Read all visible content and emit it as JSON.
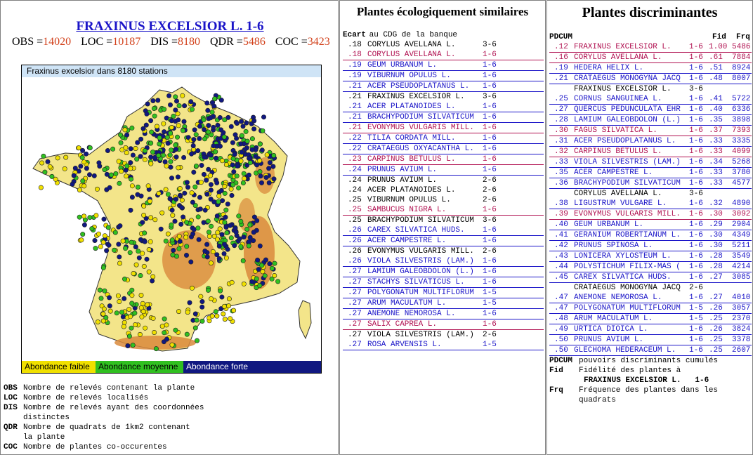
{
  "left": {
    "title": "FRAXINUS EXCELSIOR L. 1-6",
    "stats": [
      {
        "label": "OBS =",
        "value": "14020"
      },
      {
        "label": "LOC =",
        "value": "10187"
      },
      {
        "label": "DIS =",
        "value": "8180"
      },
      {
        "label": "QDR =",
        "value": "5486"
      },
      {
        "label": "COC =",
        "value": "3423"
      }
    ],
    "map": {
      "title": "Fraxinus excelsior dans 8180 stations",
      "legend": [
        "Abondance faible",
        "Abondance moyenne",
        "Abondance forte"
      ],
      "colors": {
        "low": "#f0e000",
        "mid": "#30c020",
        "high": "#101880",
        "land": "#f3e58a",
        "relief": "#d98a3c",
        "sea": "#ffffff"
      }
    },
    "definitions": [
      {
        "key": "OBS",
        "text": "Nombre de relevés contenant la plante"
      },
      {
        "key": "LOC",
        "text": "Nombre de relevés localisés"
      },
      {
        "key": "DIS",
        "text": "Nombre de relevés ayant des coordonnées"
      },
      {
        "key": "",
        "text": "distinctes"
      },
      {
        "key": "QDR",
        "text": "Nombre de quadrats de 1km2 contenant"
      },
      {
        "key": "",
        "text": "la plante"
      },
      {
        "key": "COC",
        "text": "Nombre de plantes co-occurentes"
      }
    ]
  },
  "middle": {
    "title": "Plantes écologiquement similaires",
    "subheader_bold": "Ecart",
    "subheader_rest": " au CDG de la banque",
    "rows": [
      {
        "ecart": ".18",
        "name": "CORYLUS AVELLANA L.",
        "range": "3-6",
        "style": "plain"
      },
      {
        "ecart": ".18",
        "name": "CORYLUS AVELLANA L.",
        "range": "1-6",
        "style": "red"
      },
      {
        "ecart": ".19",
        "name": "GEUM URBANUM L.",
        "range": "1-6",
        "style": "blue"
      },
      {
        "ecart": ".19",
        "name": "VIBURNUM OPULUS L.",
        "range": "1-6",
        "style": "blue"
      },
      {
        "ecart": ".21",
        "name": "ACER PSEUDOPLATANUS L.",
        "range": "1-6",
        "style": "blue"
      },
      {
        "ecart": ".21",
        "name": "FRAXINUS EXCELSIOR L.",
        "range": "3-6",
        "style": "plain"
      },
      {
        "ecart": ".21",
        "name": "ACER PLATANOIDES L.",
        "range": "1-6",
        "style": "blue"
      },
      {
        "ecart": ".21",
        "name": "BRACHYPODIUM SILVATICUM",
        "range": "1-6",
        "style": "blue"
      },
      {
        "ecart": ".21",
        "name": "EVONYMUS VULGARIS MILL.",
        "range": "1-6",
        "style": "red"
      },
      {
        "ecart": ".22",
        "name": "TILIA CORDATA MILL.",
        "range": "1-6",
        "style": "blue"
      },
      {
        "ecart": ".22",
        "name": "CRATAEGUS OXYACANTHA L.",
        "range": "1-6",
        "style": "blue"
      },
      {
        "ecart": ".23",
        "name": "CARPINUS BETULUS L.",
        "range": "1-6",
        "style": "red"
      },
      {
        "ecart": ".24",
        "name": "PRUNUS AVIUM L.",
        "range": "1-6",
        "style": "blue"
      },
      {
        "ecart": ".24",
        "name": "PRUNUS AVIUM L.",
        "range": "2-6",
        "style": "plain"
      },
      {
        "ecart": ".24",
        "name": "ACER PLATANOIDES L.",
        "range": "2-6",
        "style": "plain"
      },
      {
        "ecart": ".25",
        "name": "VIBURNUM OPULUS L.",
        "range": "2-6",
        "style": "plain"
      },
      {
        "ecart": ".25",
        "name": "SAMBUCUS NIGRA L.",
        "range": "1-6",
        "style": "red"
      },
      {
        "ecart": ".25",
        "name": "BRACHYPODIUM SILVATICUM",
        "range": "3-6",
        "style": "plain"
      },
      {
        "ecart": ".26",
        "name": "CAREX SILVATICA HUDS.",
        "range": "1-6",
        "style": "blue"
      },
      {
        "ecart": ".26",
        "name": "ACER CAMPESTRE L.",
        "range": "1-6",
        "style": "blue"
      },
      {
        "ecart": ".26",
        "name": "EVONYMUS VULGARIS MILL.",
        "range": "2-6",
        "style": "plain"
      },
      {
        "ecart": ".26",
        "name": "VIOLA SILVESTRIS (LAM.)",
        "range": "1-6",
        "style": "blue"
      },
      {
        "ecart": ".27",
        "name": "LAMIUM GALEOBDOLON (L.)",
        "range": "1-6",
        "style": "blue"
      },
      {
        "ecart": ".27",
        "name": "STACHYS SILVATICUS L.",
        "range": "1-6",
        "style": "blue"
      },
      {
        "ecart": ".27",
        "name": "POLYGONATUM MULTIFLORUM",
        "range": "1-5",
        "style": "blue"
      },
      {
        "ecart": ".27",
        "name": "ARUM MACULATUM L.",
        "range": "1-5",
        "style": "blue"
      },
      {
        "ecart": ".27",
        "name": "ANEMONE NEMOROSA L.",
        "range": "1-6",
        "style": "blue"
      },
      {
        "ecart": ".27",
        "name": "SALIX CAPREA L.",
        "range": "1-6",
        "style": "red"
      },
      {
        "ecart": ".27",
        "name": "VIOLA SILVESTRIS (LAM.)",
        "range": "2-6",
        "style": "plain"
      },
      {
        "ecart": ".27",
        "name": "ROSA ARVENSIS L.",
        "range": "1-5",
        "style": "blue"
      }
    ]
  },
  "right": {
    "title": "Plantes discriminantes",
    "col_pdcum": "PDCUM",
    "col_fid": "Fid",
    "col_frq": "Frq",
    "rows": [
      {
        "pd": ".12",
        "name": "FRAXINUS EXCELSIOR L.",
        "range": "1-6",
        "fid": "1.00",
        "frq": "5486",
        "style": "red"
      },
      {
        "pd": ".16",
        "name": "CORYLUS AVELLANA L.",
        "range": "1-6",
        "fid": ".61",
        "frq": "7884",
        "style": "red"
      },
      {
        "pd": ".19",
        "name": "HEDERA HELIX L.",
        "range": "1-6",
        "fid": ".51",
        "frq": "8924",
        "style": "blue"
      },
      {
        "pd": ".21",
        "name": "CRATAEGUS MONOGYNA JACQ",
        "range": "1-6",
        "fid": ".48",
        "frq": "8007",
        "style": "blue"
      },
      {
        "pd": "",
        "name": "FRAXINUS EXCELSIOR L.",
        "range": "3-6",
        "fid": "",
        "frq": "",
        "style": "plain"
      },
      {
        "pd": ".25",
        "name": "CORNUS SANGUINEA L.",
        "range": "1-6",
        "fid": ".41",
        "frq": "5722",
        "style": "blue"
      },
      {
        "pd": ".27",
        "name": "QUERCUS PEDUNCULATA EHR",
        "range": "1-6",
        "fid": ".40",
        "frq": "6336",
        "style": "blue"
      },
      {
        "pd": ".28",
        "name": "LAMIUM GALEOBDOLON (L.)",
        "range": "1-6",
        "fid": ".35",
        "frq": "3898",
        "style": "blue"
      },
      {
        "pd": ".30",
        "name": "FAGUS SILVATICA L.",
        "range": "1-6",
        "fid": ".37",
        "frq": "7393",
        "style": "red"
      },
      {
        "pd": ".31",
        "name": "ACER PSEUDOPLATANUS L.",
        "range": "1-6",
        "fid": ".33",
        "frq": "3335",
        "style": "blue"
      },
      {
        "pd": ".32",
        "name": "CARPINUS BETULUS L.",
        "range": "1-6",
        "fid": ".33",
        "frq": "4099",
        "style": "red"
      },
      {
        "pd": ".33",
        "name": "VIOLA SILVESTRIS (LAM.)",
        "range": "1-6",
        "fid": ".34",
        "frq": "5268",
        "style": "blue"
      },
      {
        "pd": ".35",
        "name": "ACER CAMPESTRE L.",
        "range": "1-6",
        "fid": ".33",
        "frq": "3780",
        "style": "blue"
      },
      {
        "pd": ".36",
        "name": "BRACHYPODIUM SILVATICUM",
        "range": "1-6",
        "fid": ".33",
        "frq": "4577",
        "style": "blue"
      },
      {
        "pd": "",
        "name": "CORYLUS AVELLANA L.",
        "range": "3-6",
        "fid": "",
        "frq": "",
        "style": "plain"
      },
      {
        "pd": ".38",
        "name": "LIGUSTRUM VULGARE L.",
        "range": "1-6",
        "fid": ".32",
        "frq": "4890",
        "style": "blue"
      },
      {
        "pd": ".39",
        "name": "EVONYMUS VULGARIS MILL.",
        "range": "1-6",
        "fid": ".30",
        "frq": "3092",
        "style": "red"
      },
      {
        "pd": ".40",
        "name": "GEUM URBANUM L.",
        "range": "1-6",
        "fid": ".29",
        "frq": "2904",
        "style": "blue"
      },
      {
        "pd": ".41",
        "name": "GERANIUM ROBERTIANUM L.",
        "range": "1-6",
        "fid": ".30",
        "frq": "4349",
        "style": "blue"
      },
      {
        "pd": ".42",
        "name": "PRUNUS SPINOSA L.",
        "range": "1-6",
        "fid": ".30",
        "frq": "5211",
        "style": "blue"
      },
      {
        "pd": ".43",
        "name": "LONICERA XYLOSTEUM L.",
        "range": "1-6",
        "fid": ".28",
        "frq": "3549",
        "style": "blue"
      },
      {
        "pd": ".44",
        "name": "POLYSTICHUM FILIX-MAS (",
        "range": "1-6",
        "fid": ".28",
        "frq": "4214",
        "style": "blue"
      },
      {
        "pd": ".45",
        "name": "CAREX SILVATICA HUDS.",
        "range": "1-6",
        "fid": ".27",
        "frq": "3085",
        "style": "blue"
      },
      {
        "pd": "",
        "name": "CRATAEGUS MONOGYNA JACQ",
        "range": "2-6",
        "fid": "",
        "frq": "",
        "style": "plain"
      },
      {
        "pd": ".47",
        "name": "ANEMONE NEMOROSA L.",
        "range": "1-6",
        "fid": ".27",
        "frq": "4010",
        "style": "blue"
      },
      {
        "pd": ".47",
        "name": "POLYGONATUM MULTIFLORUM",
        "range": "1-5",
        "fid": ".26",
        "frq": "3057",
        "style": "blue"
      },
      {
        "pd": ".48",
        "name": "ARUM MACULATUM L.",
        "range": "1-5",
        "fid": ".25",
        "frq": "2370",
        "style": "blue"
      },
      {
        "pd": ".49",
        "name": "URTICA DIOICA L.",
        "range": "1-6",
        "fid": ".26",
        "frq": "3824",
        "style": "blue"
      },
      {
        "pd": ".50",
        "name": "PRUNUS AVIUM L.",
        "range": "1-6",
        "fid": ".25",
        "frq": "3378",
        "style": "blue"
      },
      {
        "pd": ".50",
        "name": "GLECHOMA HEDERACEUM L.",
        "range": "1-6",
        "fid": ".25",
        "frq": "2607",
        "style": "blue"
      }
    ],
    "footer": [
      {
        "key": "PDCUM",
        "text": "pouvoirs discriminants cumulés"
      },
      {
        "key": "Fid",
        "text": "Fidélité des plantes à"
      },
      {
        "key": "",
        "text": "FRAXINUS EXCELSIOR L.   1-6",
        "bold": true
      },
      {
        "key": "Frq",
        "text": "Fréquence des plantes dans les"
      },
      {
        "key": "",
        "text": "quadrats"
      }
    ]
  }
}
